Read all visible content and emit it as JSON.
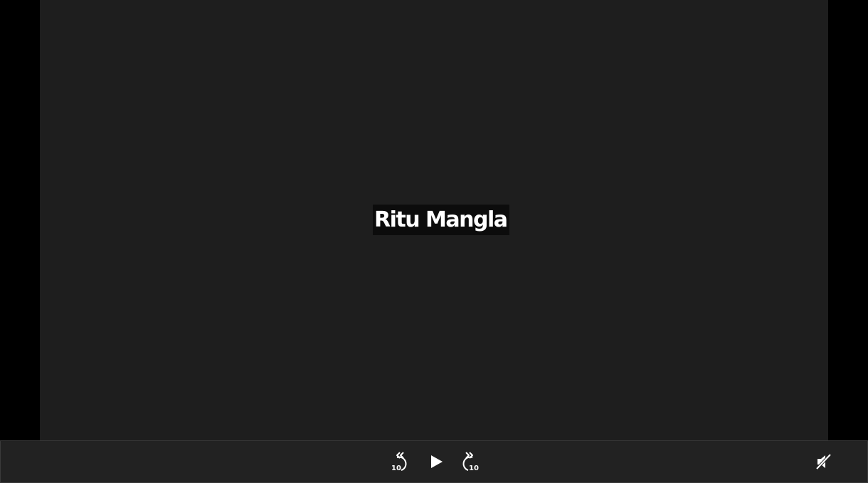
{
  "video": {
    "participant_name": "Ritu Mangla"
  },
  "controls": {
    "rewind": {
      "icon": "rewind-10-icon",
      "seconds_label": "10"
    },
    "play": {
      "icon": "play-icon"
    },
    "forward": {
      "icon": "forward-10-icon",
      "seconds_label": "10"
    },
    "mute": {
      "icon": "volume-muted-icon"
    }
  },
  "colors": {
    "page_background": "#000000",
    "video_background": "#1e1e1e",
    "name_label_background": "#0c0c0c",
    "control_bar_background": "#222222",
    "icon_color": "#ffffff"
  }
}
